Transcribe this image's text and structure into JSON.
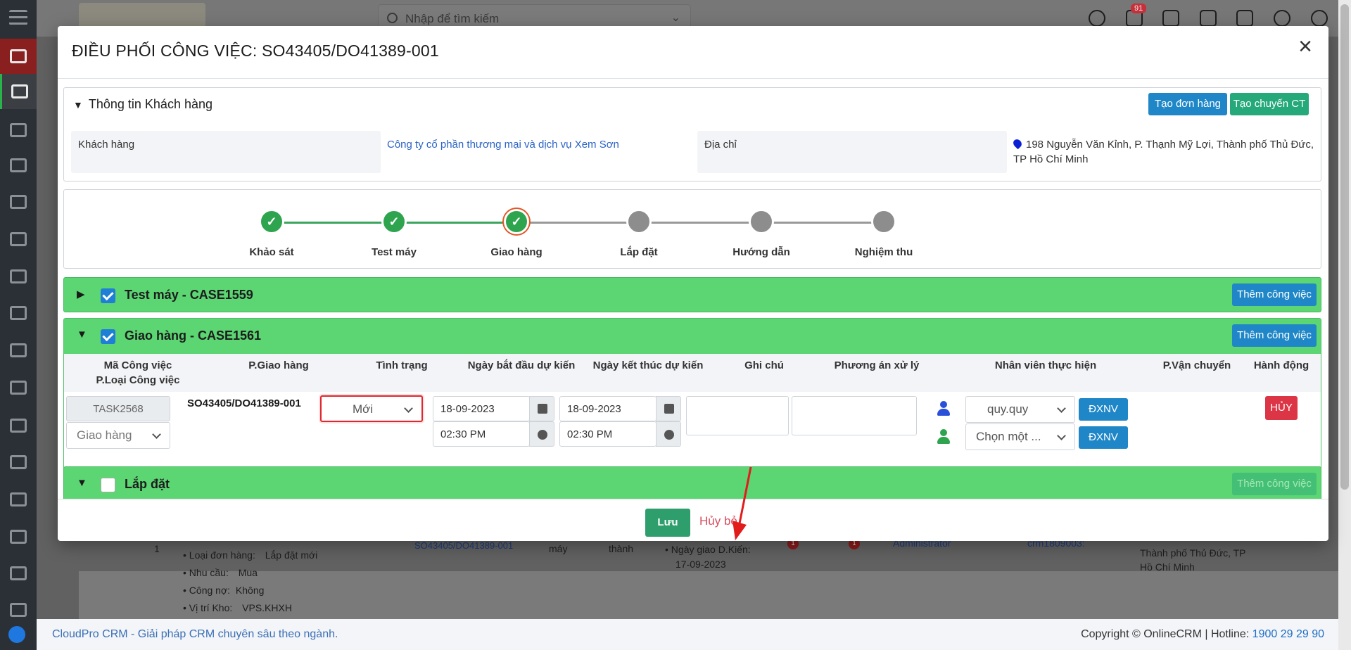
{
  "topbar": {
    "search_placeholder": "Nhập để tìm kiếm",
    "notification_count": "91"
  },
  "modal": {
    "title": "ĐIỀU PHỐI CÔNG VIỆC: SO43405/DO41389-001",
    "close": "×"
  },
  "customer": {
    "section_label": "Thông tin Khách hàng",
    "btn_create_order": "Tạo đơn hàng",
    "btn_create_ct": "Tạo chuyến CT",
    "customer_label": "Khách hàng",
    "customer_value": "Công ty cổ phần thương mại và dịch vụ Xem Sơn",
    "address_label": "Địa chỉ",
    "address_value": "198 Nguyễn Văn Kỉnh, P. Thạnh Mỹ Lợi, Thành phố Thủ Đức, TP Hồ Chí Minh"
  },
  "steps": [
    {
      "label": "Khảo sát",
      "status": "done"
    },
    {
      "label": "Test máy",
      "status": "done"
    },
    {
      "label": "Giao hàng",
      "status": "current"
    },
    {
      "label": "Lắp đặt",
      "status": "pending"
    },
    {
      "label": "Hướng dẫn",
      "status": "pending"
    },
    {
      "label": "Nghiệm thu",
      "status": "pending"
    }
  ],
  "sections": {
    "test": {
      "title": "Test máy - CASE1559",
      "add_btn": "Thêm công việc",
      "checked": true
    },
    "giao": {
      "title": "Giao hàng - CASE1561",
      "add_btn": "Thêm công việc",
      "checked": true
    },
    "lap": {
      "title": "Lắp đặt",
      "add_btn": "Thêm công việc",
      "checked": false
    }
  },
  "table": {
    "headers": {
      "ma_cv": "Mã Công việc",
      "ploai_cv": "P.Loại Công việc",
      "p_giao_hang": "P.Giao hàng",
      "tinh_trang": "Tình trạng",
      "ngay_bat_dau": "Ngày bắt đầu dự kiến",
      "ngay_ket_thuc": "Ngày kết thúc dự kiến",
      "ghi_chu": "Ghi chú",
      "phuong_an": "Phương án xử lý",
      "nhan_vien": "Nhân viên thực hiện",
      "p_van_chuyen": "P.Vận chuyển",
      "hanh_dong": "Hành động"
    },
    "row": {
      "task_code": "TASK2568",
      "task_type": "Giao hàng",
      "p_giao_hang": "SO43405/DO41389-001",
      "status": "Mới",
      "start_date": "18-09-2023",
      "start_time": "02:30 PM",
      "end_date": "18-09-2023",
      "end_time": "02:30 PM",
      "staff_1": "quy.quy",
      "staff_2": "Chọn một ...",
      "btn_dxnv": "ĐXNV",
      "btn_huy": "HỦY"
    }
  },
  "footer_buttons": {
    "save": "Lưu",
    "cancel": "Hủy bỏ"
  },
  "background": {
    "rows": {
      "loai_don_hang_label": "Loại đơn hàng:",
      "loai_don_hang_value": "Lắp đặt mới",
      "nhu_cau_label": "Nhu cầu:",
      "nhu_cau_value": "Mua",
      "cong_no_label": "Công nợ:",
      "cong_no_value": "Không",
      "vi_tri_kho_label": "Vị trí Kho:",
      "vi_tri_kho_value": "VPS.KHXH",
      "row_index": "1",
      "so_ref": "SO43405/DO41389-001",
      "may": "máy",
      "thanh": "thành",
      "ngay_giao_label": "Ngày giao D.Kiến:",
      "ngay_giao_value": "17-09-2023",
      "badge_1": "1",
      "badge_2": "1",
      "admin": "Administrator",
      "crm_ref": "crm1809003:",
      "addr_partial": "Thành phố Thủ Đức, TP Hồ Chí Minh"
    }
  },
  "app_footer": {
    "left": "CloudPro CRM - Giải pháp CRM chuyên sâu theo ngành.",
    "right_prefix": "Copyright © OnlineCRM | Hotline: ",
    "hotline": "1900 29 29 90"
  }
}
